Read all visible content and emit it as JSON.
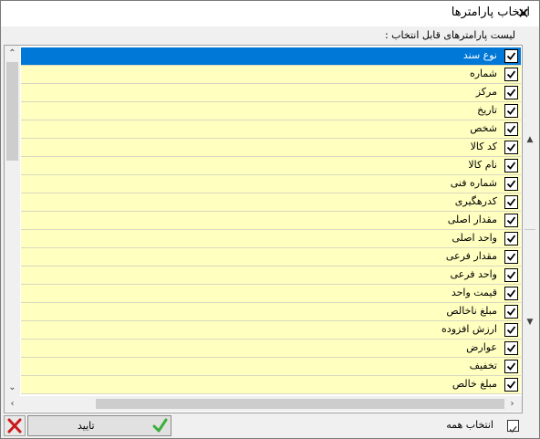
{
  "window": {
    "title": "انتخاب پارامترها",
    "close_glyph": "✕"
  },
  "list": {
    "label": "لیست پارامترهای قابل انتخاب :",
    "items": [
      {
        "label": "نوع سند",
        "checked": true,
        "selected": true
      },
      {
        "label": "شماره",
        "checked": true
      },
      {
        "label": "مرکز",
        "checked": true
      },
      {
        "label": "تاریخ",
        "checked": true
      },
      {
        "label": "شخص",
        "checked": true
      },
      {
        "label": "کد کالا",
        "checked": true
      },
      {
        "label": "نام کالا",
        "checked": true
      },
      {
        "label": "شماره فنی",
        "checked": true
      },
      {
        "label": "کدرهگیری",
        "checked": true
      },
      {
        "label": "مقدار اصلی",
        "checked": true
      },
      {
        "label": "واحد اصلی",
        "checked": true
      },
      {
        "label": "مقدار فرعی",
        "checked": true
      },
      {
        "label": "واحد فرعی",
        "checked": true
      },
      {
        "label": "قیمت واحد",
        "checked": true
      },
      {
        "label": "مبلغ ناخالص",
        "checked": true
      },
      {
        "label": "ارزش افزوده",
        "checked": true
      },
      {
        "label": "عوارض",
        "checked": true
      },
      {
        "label": "تخفیف",
        "checked": true
      },
      {
        "label": "مبلغ خالص",
        "checked": true
      }
    ]
  },
  "footer": {
    "ok_label": "تایید",
    "select_all_label": "انتخاب همه",
    "select_all_checked": true
  },
  "colors": {
    "selected_row": "#0078d7",
    "row_bg": "#ffffc0",
    "ok_tick": "#3cae3c",
    "cancel_x": "#cc1a1a"
  }
}
